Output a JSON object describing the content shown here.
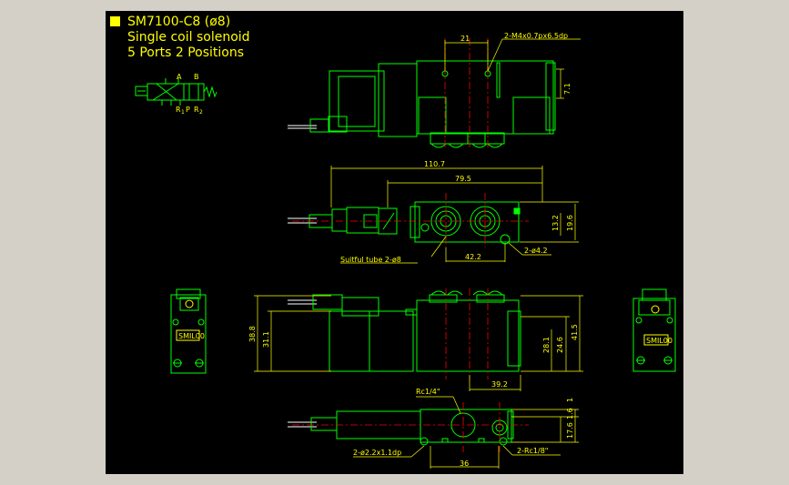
{
  "title": {
    "line1": "SM7100-C8 (ø8)",
    "line2": "Single coil solenoid",
    "line3": "5 Ports 2 Positions"
  },
  "symbol": {
    "port_a": "A",
    "port_b": "B",
    "port_r1": "R",
    "port_r1_sub": "1",
    "port_p": "P",
    "port_r2": "R",
    "port_r2_sub": "2"
  },
  "labels": {
    "label_plate_front": "SMIL00",
    "label_plate_side": "SMIL00"
  },
  "dimensions": {
    "top_view": {
      "pitch": "21",
      "threads": "2-M4x0.7px6.5dp",
      "height": "7.1"
    },
    "plan_view": {
      "overall": "110.7",
      "body": "79.5",
      "h1": "13.2",
      "h2": "19.6",
      "tube": "Suitful tube 2-ø8",
      "port_pitch": "42.2",
      "mount_holes": "2-ø4.2"
    },
    "side_view": {
      "h_total": "38.8",
      "h_body": "31.1",
      "h_port": "24.6",
      "h_base": "28.1",
      "h_max": "41.5",
      "spacing": "39.2"
    },
    "bottom_view": {
      "port_main": "Rc1/4\"",
      "ports_pilot": "2-Rc1/8\"",
      "holes": "2-ø2.2x1.1dp",
      "pitch": "36",
      "h_a": "1",
      "h_b": "1.6",
      "h_c": "17.6"
    }
  },
  "colors": {
    "background": "#000000",
    "frame": "#d4d0c8",
    "outline": "#00ff00",
    "dimension": "#ffff00",
    "centerline": "#ff0000",
    "port": "#00ffff",
    "wire": "#ffffff"
  }
}
